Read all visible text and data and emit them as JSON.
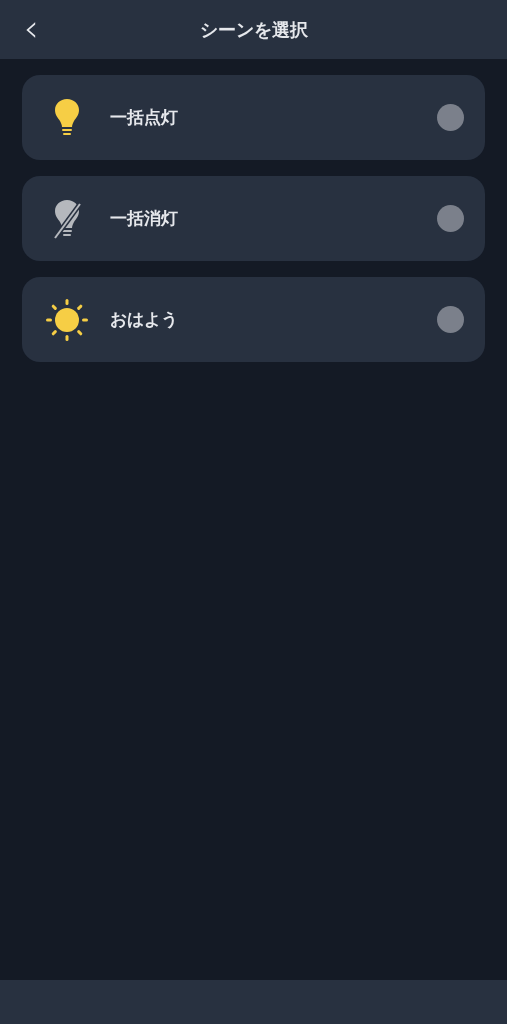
{
  "header": {
    "back": "‹",
    "title": "シーンを選択"
  },
  "scenes": [
    {
      "label": "一括点灯",
      "selected": false
    },
    {
      "label": "一括消灯",
      "selected": false
    },
    {
      "label": "おはよう",
      "selected": false
    }
  ]
}
